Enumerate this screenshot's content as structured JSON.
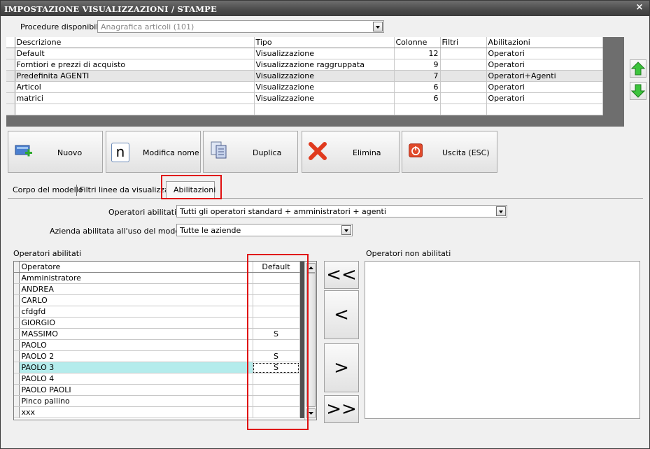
{
  "window": {
    "title": "IMPOSTAZIONE VISUALIZZAZIONI / STAMPE",
    "close": "×"
  },
  "procedure": {
    "label": "Procedure disponibili :",
    "value": "Anagrafica articoli (101)"
  },
  "grid": {
    "headers": [
      "Descrizione",
      "Tipo",
      "Colonne",
      "Filtri",
      "Abilitazioni"
    ],
    "rows": [
      [
        "Default",
        "Visualizzazione",
        "12",
        "",
        "Operatori"
      ],
      [
        "Forntiori e prezzi di acquisto",
        "Visualizzazione raggruppata",
        "9",
        "",
        "Operatori"
      ],
      [
        "Predefinita AGENTI",
        "Visualizzazione",
        "7",
        "",
        "Operatori+Agenti"
      ],
      [
        "Articol",
        "Visualizzazione",
        "6",
        "",
        "Operatori"
      ],
      [
        "matrici",
        "Visualizzazione",
        "6",
        "",
        "Operatori"
      ]
    ]
  },
  "buttons": {
    "nuovo": "Nuovo",
    "modifica": "Modifica nome",
    "modifica_icon": "n",
    "duplica": "Duplica",
    "elimina": "Elimina",
    "uscita": "Uscita (ESC)"
  },
  "tabs": [
    "Corpo del modello",
    "Filtri linee da visualizzare",
    "Abilitazioni"
  ],
  "filters": {
    "operatori_label": "Operatori abilitati :",
    "operatori_value": "Tutti gli operatori standard + amministratori + agenti",
    "azienda_label": "Azienda abilitata all'uso del modello :",
    "azienda_value": "Tutte le aziende"
  },
  "operatori": {
    "title": "Operatori abilitati",
    "headers": [
      "Operatore",
      "Default"
    ],
    "rows": [
      [
        "Amministratore",
        ""
      ],
      [
        "ANDREA",
        ""
      ],
      [
        "CARLO",
        ""
      ],
      [
        "cfdgfd",
        ""
      ],
      [
        "GIORGIO",
        ""
      ],
      [
        "MASSIMO",
        "S"
      ],
      [
        "PAOLO",
        ""
      ],
      [
        "PAOLO 2",
        "S"
      ],
      [
        "PAOLO 3",
        "S"
      ],
      [
        "PAOLO 4",
        ""
      ],
      [
        "PAOLO PAOLI",
        ""
      ],
      [
        "Pinco pallino",
        ""
      ],
      [
        "xxx",
        ""
      ]
    ]
  },
  "move": {
    "all_left": "<<",
    "left": "<",
    "right": ">",
    "all_right": ">>"
  },
  "non_abilitati": {
    "title": "Operatori non abilitati"
  },
  "colors": {
    "accent_red": "#e01010",
    "highlight_row": "#b4ecec",
    "titlebar": "#4a4a4a"
  }
}
